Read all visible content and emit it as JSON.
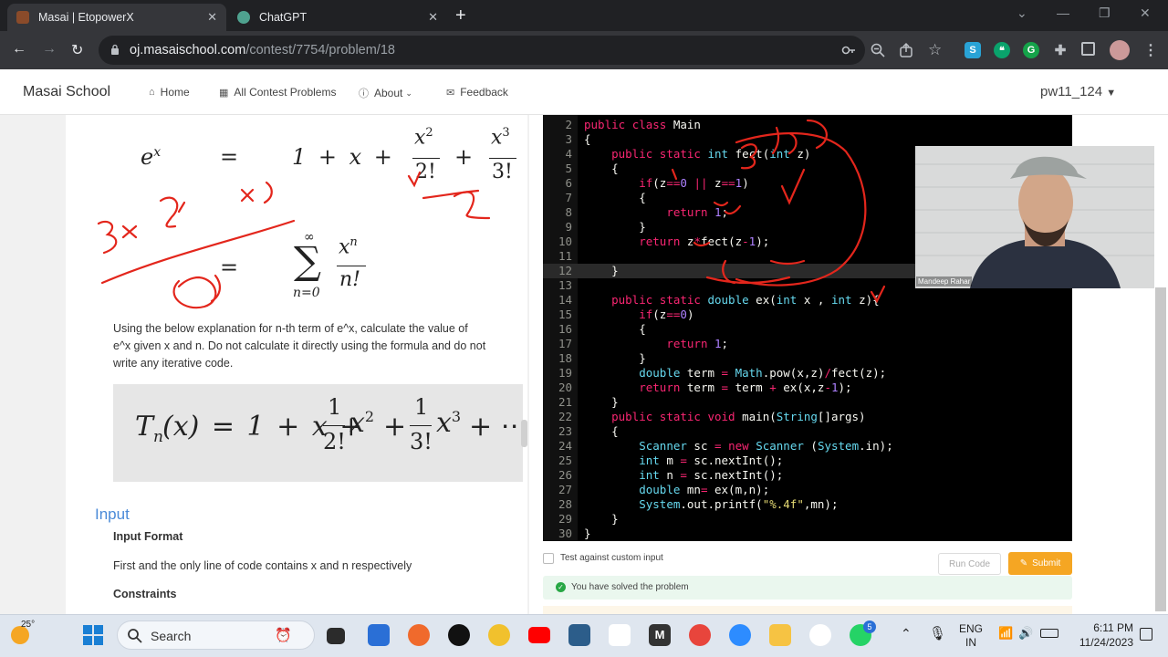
{
  "browser": {
    "tabs": [
      {
        "title": "Masai | EtopowerX",
        "active": true
      },
      {
        "title": "ChatGPT",
        "active": false
      }
    ],
    "url_host": "oj.masaischool.com",
    "url_path": "/contest/7754/problem/18"
  },
  "site": {
    "brand": "Masai School",
    "nav": [
      {
        "label": "Home",
        "icon": "home-icon"
      },
      {
        "label": "All Contest Problems",
        "icon": "grid-icon"
      },
      {
        "label": "About",
        "icon": "info-icon"
      },
      {
        "label": "Feedback",
        "icon": "feedback-icon"
      }
    ],
    "user": "pw11_124"
  },
  "problem": {
    "math1": {
      "lhs": "e",
      "lhs_sup": "x",
      "eq": "=",
      "rhs": "1 + x +",
      "frac2_num": "x",
      "frac2_sup": "2",
      "frac2_den": "2!",
      "plus": "+",
      "frac3_num": "x",
      "frac3_sup": "3",
      "frac3_den": "3!"
    },
    "math2": {
      "eq": "=",
      "sum": "∑",
      "sum_top": "∞",
      "sum_bottom": "n=0",
      "frac_num": "x",
      "frac_sup": "n",
      "frac_den": "n!"
    },
    "description": "Using the below explanation for n-th term of e^x, calculate the value of e^x given x and n. Do not calculate it directly using the formula and do not write any iterative code.",
    "formula": {
      "lhs": "T",
      "lhs_sub": "n",
      "arg": "(x) = 1 + x +",
      "a_num": "1",
      "a_den": "2!",
      "a_var": "x",
      "a_sup": "2",
      "plus": "+",
      "b_num": "1",
      "b_den": "3!",
      "b_var": "x",
      "b_sup": "3",
      "tail": "+ ⋯"
    },
    "input_heading": "Input",
    "input_format_label": "Input Format",
    "input_format_text": "First and the only line of code contains x and n respectively",
    "constraints_label": "Constraints"
  },
  "editor": {
    "lines": [
      {
        "n": "2",
        "code": "public class Main"
      },
      {
        "n": "3",
        "code": "{"
      },
      {
        "n": "4",
        "code": "    public static int fect(int z)"
      },
      {
        "n": "5",
        "code": "    {"
      },
      {
        "n": "6",
        "code": "        if(z==0 || z==1)"
      },
      {
        "n": "7",
        "code": "        {"
      },
      {
        "n": "8",
        "code": "            return 1;"
      },
      {
        "n": "9",
        "code": "        }"
      },
      {
        "n": "10",
        "code": "        return z*fect(z-1);"
      },
      {
        "n": "11",
        "code": ""
      },
      {
        "n": "12",
        "code": "    }"
      },
      {
        "n": "13",
        "code": ""
      },
      {
        "n": "14",
        "code": "    public static double ex(int x , int z){"
      },
      {
        "n": "15",
        "code": "        if(z==0)"
      },
      {
        "n": "16",
        "code": "        {"
      },
      {
        "n": "17",
        "code": "            return 1;"
      },
      {
        "n": "18",
        "code": "        }"
      },
      {
        "n": "19",
        "code": "        double term = Math.pow(x,z)/fect(z);"
      },
      {
        "n": "20",
        "code": "        return term = term + ex(x,z-1);"
      },
      {
        "n": "21",
        "code": "    }"
      },
      {
        "n": "22",
        "code": "    public static void main(String[]args)"
      },
      {
        "n": "23",
        "code": "    {"
      },
      {
        "n": "24",
        "code": "        Scanner sc = new Scanner (System.in);"
      },
      {
        "n": "25",
        "code": "        int m = sc.nextInt();"
      },
      {
        "n": "26",
        "code": "        int n = sc.nextInt();"
      },
      {
        "n": "27",
        "code": "        double mn= ex(m,n);"
      },
      {
        "n": "28",
        "code": "        System.out.printf(\"%.4f\",mn);"
      },
      {
        "n": "29",
        "code": "    }"
      },
      {
        "n": "30",
        "code": "}"
      }
    ],
    "highlight_line": "12",
    "custom_input_label": "Test against custom input",
    "run_label": "Run Code",
    "submit_label": "Submit",
    "solved_message": "You have solved the problem"
  },
  "webcam": {
    "name": "Mandeep Rahar"
  },
  "taskbar": {
    "weather": "25°",
    "search_label": "Search",
    "lang_top": "ENG",
    "lang_bottom": "IN",
    "time": "6:11 PM",
    "date": "11/24/2023",
    "whatsapp_badge": "5"
  },
  "colors": {
    "submit": "#f5a623",
    "link": "#4a8ad8",
    "annotation": "#e3261c",
    "keyword": "#f92672",
    "type": "#66d9ef"
  }
}
